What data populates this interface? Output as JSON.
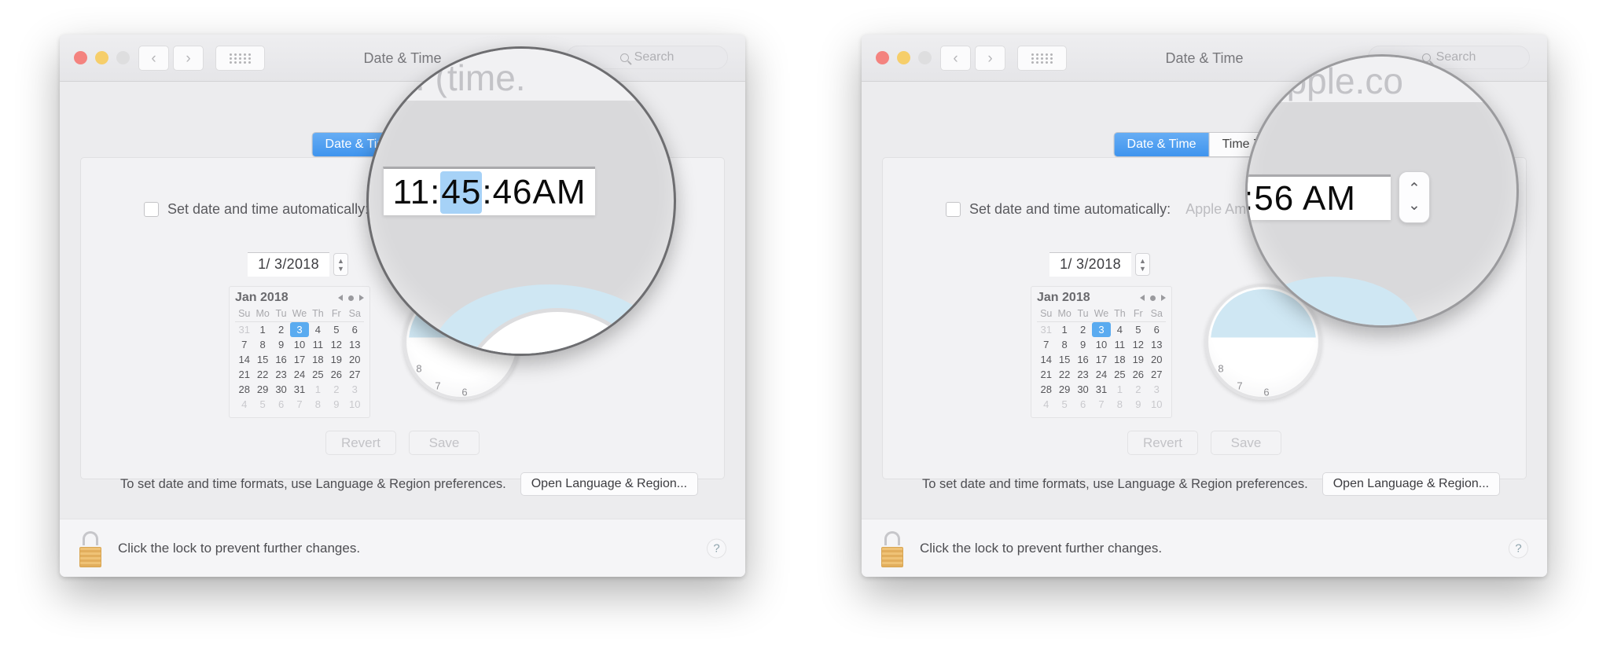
{
  "window_title": "Date & Time",
  "search": {
    "placeholder": "Search",
    "icon": "search-icon"
  },
  "toolbar": {
    "back_icon": "chevron-left-icon",
    "forward_icon": "chevron-right-icon",
    "grid_icon": "show-all-grid-icon"
  },
  "tabs": [
    {
      "label": "Date & Time",
      "active": true
    },
    {
      "label": "Time Zone",
      "active": false
    }
  ],
  "auto": {
    "checkbox_label": "Set date and time automatically:",
    "server_value": "Apple Americas/U.S. (time.apple.com)",
    "server_value_left_visible": "s. (time.",
    "server_value_right_visible": "Apple Am",
    "checked": false
  },
  "date_field": {
    "value": "1/  3/2018",
    "stepper_up": "▲",
    "stepper_down": "▼"
  },
  "calendar": {
    "month": "Jan 2018",
    "nav": {
      "prev": "prev-month-arrow",
      "today": "today-dot",
      "next": "next-month-arrow"
    },
    "weekdays": [
      "Su",
      "Mo",
      "Tu",
      "We",
      "Th",
      "Fr",
      "Sa"
    ],
    "weeks": [
      [
        {
          "d": "31",
          "dim": true
        },
        {
          "d": "1"
        },
        {
          "d": "2"
        },
        {
          "d": "3",
          "sel": true
        },
        {
          "d": "4"
        },
        {
          "d": "5"
        },
        {
          "d": "6"
        }
      ],
      [
        {
          "d": "7"
        },
        {
          "d": "8"
        },
        {
          "d": "9"
        },
        {
          "d": "10"
        },
        {
          "d": "11"
        },
        {
          "d": "12"
        },
        {
          "d": "13"
        }
      ],
      [
        {
          "d": "14"
        },
        {
          "d": "15"
        },
        {
          "d": "16"
        },
        {
          "d": "17"
        },
        {
          "d": "18"
        },
        {
          "d": "19"
        },
        {
          "d": "20"
        }
      ],
      [
        {
          "d": "21"
        },
        {
          "d": "22"
        },
        {
          "d": "23"
        },
        {
          "d": "24"
        },
        {
          "d": "25"
        },
        {
          "d": "26"
        },
        {
          "d": "27"
        }
      ],
      [
        {
          "d": "28"
        },
        {
          "d": "29"
        },
        {
          "d": "30"
        },
        {
          "d": "31"
        },
        {
          "d": "1",
          "dim": true
        },
        {
          "d": "2",
          "dim": true
        },
        {
          "d": "3",
          "dim": true
        }
      ],
      [
        {
          "d": "4",
          "dim": true
        },
        {
          "d": "5",
          "dim": true
        },
        {
          "d": "6",
          "dim": true
        },
        {
          "d": "7",
          "dim": true
        },
        {
          "d": "8",
          "dim": true
        },
        {
          "d": "9",
          "dim": true
        },
        {
          "d": "10",
          "dim": true
        }
      ]
    ]
  },
  "buttons": {
    "revert": "Revert",
    "save": "Save"
  },
  "format_row": {
    "text": "To set date and time formats, use Language & Region preferences.",
    "button": "Open Language & Region..."
  },
  "footer": {
    "text": "Click the lock to prevent further changes.",
    "lock_icon": "unlocked-padlock-icon",
    "help": "?"
  },
  "left_loupe": {
    "time_full": "11:45:46 AM",
    "time_hours": "11",
    "sep1": ":",
    "time_minutes_selected": "45",
    "sep2": ":",
    "time_seconds": "46",
    "meridiem": " AM",
    "background_text": "s. (time."
  },
  "right_loupe": {
    "time_visible": ":56 AM",
    "background_text": "apple.co",
    "stepper_up": "⌃",
    "stepper_down": "⌄"
  },
  "clock_numbers": [
    "6",
    "7",
    "8"
  ],
  "colors": {
    "accent_blue": "#3f94ee",
    "selection_blue": "#5aabf0",
    "window_bg": "#ececee",
    "panel_bg": "#f2f2f4"
  }
}
